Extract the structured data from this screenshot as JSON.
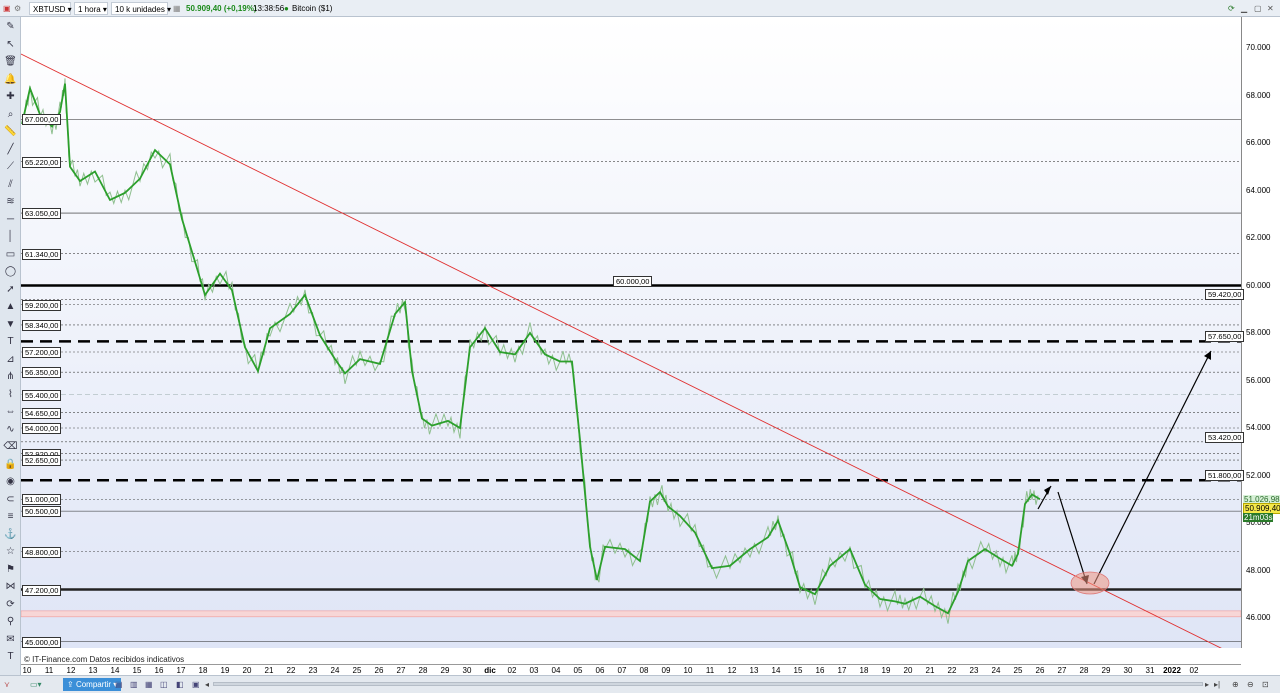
{
  "toolbar": {
    "symbol": "XBTUSD",
    "timeframe": "1 hora",
    "units": "10 k unidades",
    "last_price": "50.909,40 (+0,19%)",
    "time": "13:38:56",
    "instrument": "Bitcoin ($1)"
  },
  "chart": {
    "credits": "© IT-Finance.com  Datos recibidos indicativos",
    "current_price": "50.909,40",
    "prev_price": "51.026,98",
    "countdown": "21m03s",
    "channel_center_label": "60.000,00"
  },
  "y_axis": [
    "70.000",
    "68.000",
    "66.000",
    "64.000",
    "62.000",
    "60.000",
    "58.000",
    "56.000",
    "54.000",
    "52.000",
    "50.000",
    "48.000",
    "46.000"
  ],
  "x_axis": [
    "10",
    "11",
    "12",
    "13",
    "14",
    "15",
    "16",
    "17",
    "18",
    "19",
    "20",
    "21",
    "22",
    "23",
    "24",
    "25",
    "26",
    "27",
    "28",
    "29",
    "30",
    "dic",
    "02",
    "03",
    "04",
    "05",
    "06",
    "07",
    "08",
    "09",
    "10",
    "11",
    "12",
    "13",
    "14",
    "15",
    "16",
    "17",
    "18",
    "19",
    "20",
    "21",
    "22",
    "23",
    "24",
    "25",
    "26",
    "27",
    "28",
    "29",
    "30",
    "31",
    "2022",
    "02"
  ],
  "levels_left": [
    {
      "label": "67.000,00",
      "value": 67000,
      "style": "solid-thin"
    },
    {
      "label": "65.220,00",
      "value": 65220,
      "style": "dotted"
    },
    {
      "label": "63.050,00",
      "value": 63050,
      "style": "solid-thin"
    },
    {
      "label": "61.340,00",
      "value": 61340,
      "style": "dotted"
    },
    {
      "label": "59.200,00",
      "value": 59200,
      "style": "dotted"
    },
    {
      "label": "58.340,00",
      "value": 58340,
      "style": "dotted"
    },
    {
      "label": "57.200,00",
      "value": 57200,
      "style": "dotted"
    },
    {
      "label": "56.350,00",
      "value": 56350,
      "style": "dotted"
    },
    {
      "label": "55.400,00",
      "value": 55400,
      "style": "dashed-grey"
    },
    {
      "label": "54.650,00",
      "value": 54650,
      "style": "dotted"
    },
    {
      "label": "54.000,00",
      "value": 54000,
      "style": "dotted"
    },
    {
      "label": "52.920,00",
      "value": 52920,
      "style": "dotted"
    },
    {
      "label": "52.650,00",
      "value": 52650,
      "style": "dotted"
    },
    {
      "label": "51.000,00",
      "value": 51000,
      "style": "dotted"
    },
    {
      "label": "50.500,00",
      "value": 50500,
      "style": "solid-thin"
    },
    {
      "label": "48.800,00",
      "value": 48800,
      "style": "dotted"
    },
    {
      "label": "47.200,00",
      "value": 47200,
      "style": "thick"
    },
    {
      "label": "45.000,00",
      "value": 45000,
      "style": "solid-thin"
    }
  ],
  "levels_right": [
    {
      "label": "59.420,00",
      "value": 59420
    },
    {
      "label": "57.650,00",
      "value": 57650
    },
    {
      "label": "53.420,00",
      "value": 53420
    },
    {
      "label": "51.800,00",
      "value": 51800
    }
  ],
  "bottombar": {
    "share_label": "Compartir"
  },
  "colors": {
    "trendline": "#e03030",
    "price_up": "#1a8a1a",
    "ma": "#2ca02c",
    "ma_slow": "#d08080",
    "bg_top": "#ffffff",
    "bg_bottom": "#dfe5f6"
  }
}
